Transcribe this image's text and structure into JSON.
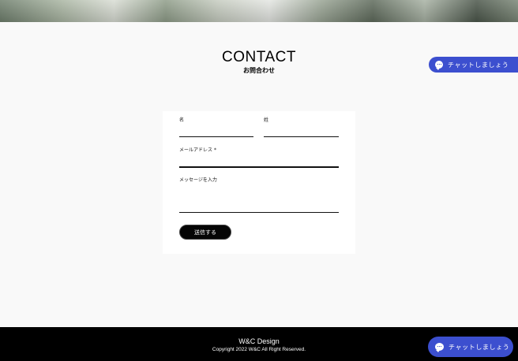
{
  "header": {
    "title": "CONTACT",
    "subtitle": "お問合わせ"
  },
  "chat": {
    "label": "チャットしましょう"
  },
  "form": {
    "first_name_label": "名",
    "last_name_label": "姓",
    "email_label": "メールアドレス",
    "email_required_mark": "*",
    "message_label": "メッセージを入力",
    "submit_label": "送信する"
  },
  "footer": {
    "brand": "W&C Design",
    "copyright": "Copyright 2022 W&C All Right Reserved."
  },
  "colors": {
    "chat_button": "#3c4fcf",
    "page_background": "#f9f9f9",
    "footer_background": "#000000"
  }
}
